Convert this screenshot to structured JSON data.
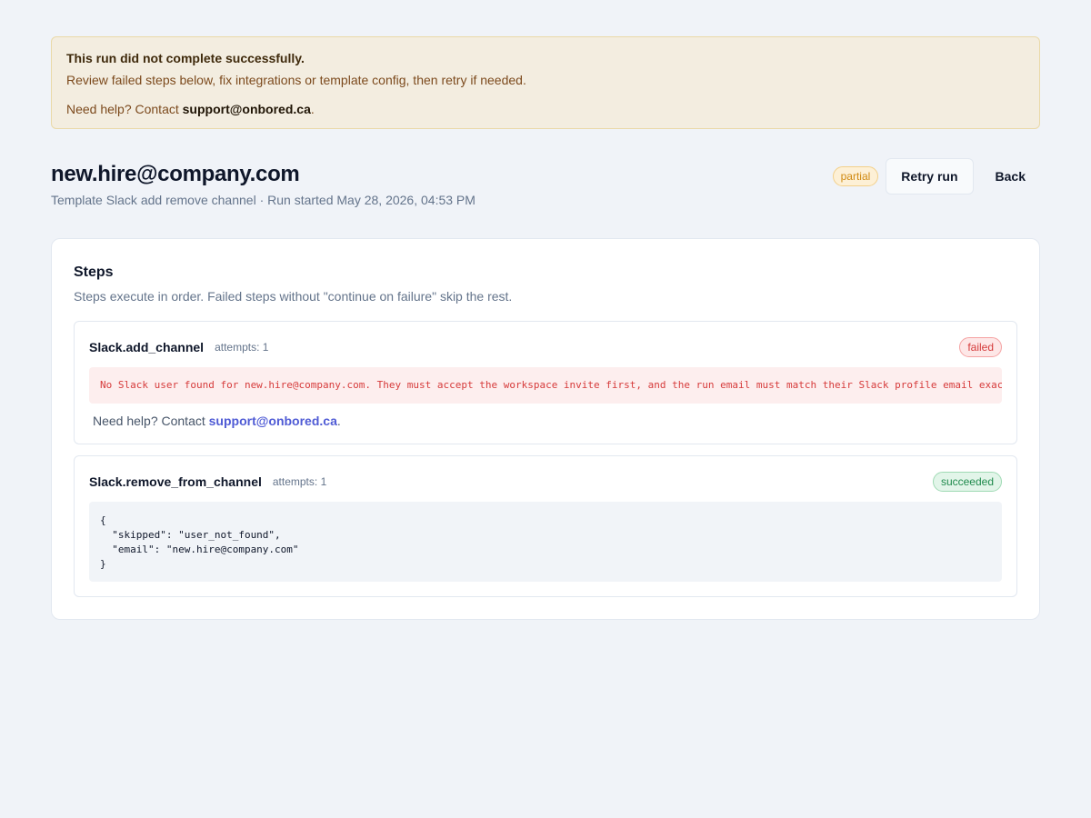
{
  "alert": {
    "title": "This run did not complete successfully.",
    "body": "Review failed steps below, fix integrations or template config, then retry if needed.",
    "help_prefix": "Need help? Contact ",
    "help_email": "support@onbored.ca",
    "help_suffix": "."
  },
  "header": {
    "title": "new.hire@company.com",
    "subtitle": "Template Slack add remove channel · Run started May 28, 2026, 04:53 PM",
    "status": "partial",
    "retry_label": "Retry run",
    "back_label": "Back"
  },
  "steps_card": {
    "title": "Steps",
    "description": "Steps execute in order. Failed steps without \"continue on failure\" skip the rest.",
    "steps": [
      {
        "name": "Slack.add_channel",
        "attempts": "attempts: 1",
        "status": "failed",
        "error": "No Slack user found for new.hire@company.com. They must accept the workspace invite first, and the run email must match their Slack profile email exactly.",
        "help_prefix": "Need help? Contact ",
        "help_email": "support@onbored.ca",
        "help_suffix": "."
      },
      {
        "name": "Slack.remove_from_channel",
        "attempts": "attempts: 1",
        "status": "succeeded",
        "output": "{\n  \"skipped\": \"user_not_found\",\n  \"email\": \"new.hire@company.com\"\n}"
      }
    ]
  },
  "colors": {
    "background": "#f0f3f8",
    "alert_bg": "#f3ede0",
    "failed": "#d53b3b",
    "succeeded": "#1f8a4c",
    "partial": "#d08a12",
    "link": "#4f5bd5"
  }
}
